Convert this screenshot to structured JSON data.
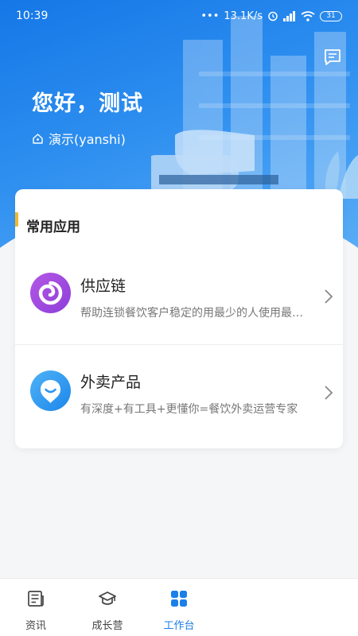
{
  "status_bar": {
    "time": "10:39",
    "network_speed": "13.1K/s",
    "battery": "31"
  },
  "header": {
    "greeting": "您好，测试",
    "organization": "演示(yanshi)"
  },
  "apps_section": {
    "title": "常用应用",
    "items": [
      {
        "name": "供应链",
        "description": "帮助连锁餐饮客户稳定的用最少的人使用最少的时间完成供应链管理",
        "icon": "supply-chain-icon"
      },
      {
        "name": "外卖产品",
        "description": "有深度+有工具+更懂你=餐饮外卖运营专家",
        "icon": "takeout-icon"
      }
    ]
  },
  "tabbar": {
    "tabs": [
      {
        "label": "资讯",
        "icon": "news-icon",
        "active": false
      },
      {
        "label": "成长营",
        "icon": "graduation-cap-icon",
        "active": false
      },
      {
        "label": "工作台",
        "icon": "grid-icon",
        "active": true
      }
    ]
  },
  "colors": {
    "primary": "#1a7fe8",
    "accent": "#f2b72c",
    "supply_icon_bg": "#9b49de",
    "takeout_icon_bg": "#2c95ef"
  }
}
